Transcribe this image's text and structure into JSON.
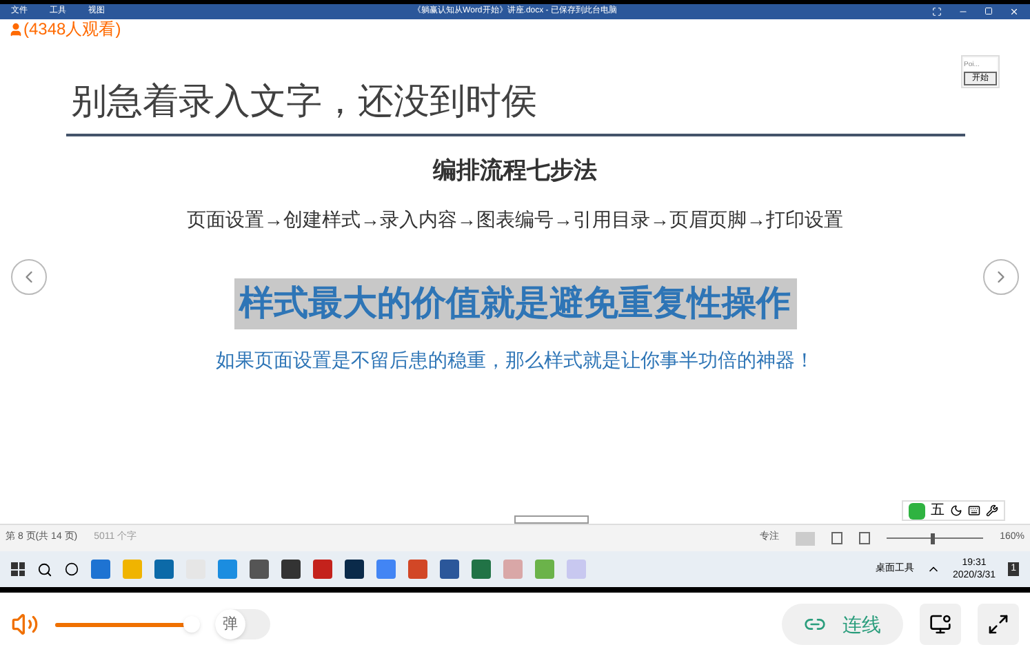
{
  "window": {
    "menu": [
      "文件",
      "工具",
      "视图"
    ],
    "title": "《躺赢认知从Word开始》讲座.docx - 已保存到此台电脑",
    "viewers": "(4348人观看)"
  },
  "slide": {
    "heading": "别急着录入文字，还没到时侯",
    "subtitle": "编排流程七步法",
    "steps": "页面设置→创建样式→录入内容→图表编号→引用目录→页眉页脚→打印设置",
    "highlight": "样式最大的价值就是避免重复性操作",
    "note": "如果页面设置是不留后患的稳重，那么样式就是让你事半功倍的神器！"
  },
  "widget": {
    "placeholder": "Poi...",
    "button": "开始"
  },
  "ime": {
    "mode": "五"
  },
  "status_bar": {
    "page": "第 8 页(共 14 页)",
    "words": "5011 个字",
    "focus": "专注",
    "zoom": "160%",
    "zoom_slider": {
      "level": 0.45
    }
  },
  "taskbar": {
    "toolbar": "桌面工具",
    "time": "19:31",
    "date": "2020/3/31",
    "notifications": "1"
  },
  "player": {
    "volume": {
      "level": 0.95
    },
    "danmaku": {
      "label": "弹",
      "on": false
    },
    "connect": "连线"
  }
}
